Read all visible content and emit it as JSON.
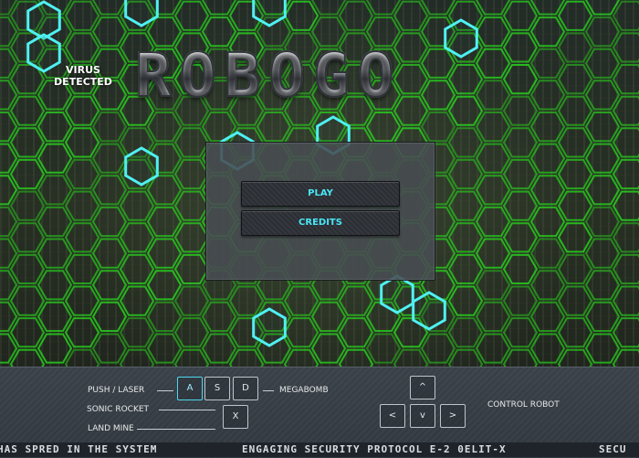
{
  "game_title": "ROBOGO",
  "virus_badge": {
    "line1": "VIRUS",
    "line2": "DETECTED"
  },
  "menu": {
    "play": "PLAY",
    "credits": "CREDITS"
  },
  "controls": {
    "push_laser": "PUSH / LASER",
    "sonic_rocket": "SONIC ROCKET",
    "land_mine": "LAND MINE",
    "megabomb": "MEGABOMB",
    "control_robot": "CONTROL  ROBOT",
    "keys": {
      "a": "A",
      "s": "S",
      "d": "D",
      "x": "X",
      "up": "^",
      "left": "<",
      "down": "v",
      "right": ">"
    }
  },
  "ticker": {
    "segment1": "HAS SPRED IN THE SYSTEM",
    "segment2": "ENGAGING SECURITY PROTOCOL E-2 0ELIT-X",
    "segment3": "SECU"
  },
  "colors": {
    "accent_cyan": "#49e6f5",
    "hex_green": "#3fae2c",
    "hex_cyan": "#4ff0f2",
    "panel": "#484c52",
    "hud": "#343a41"
  }
}
